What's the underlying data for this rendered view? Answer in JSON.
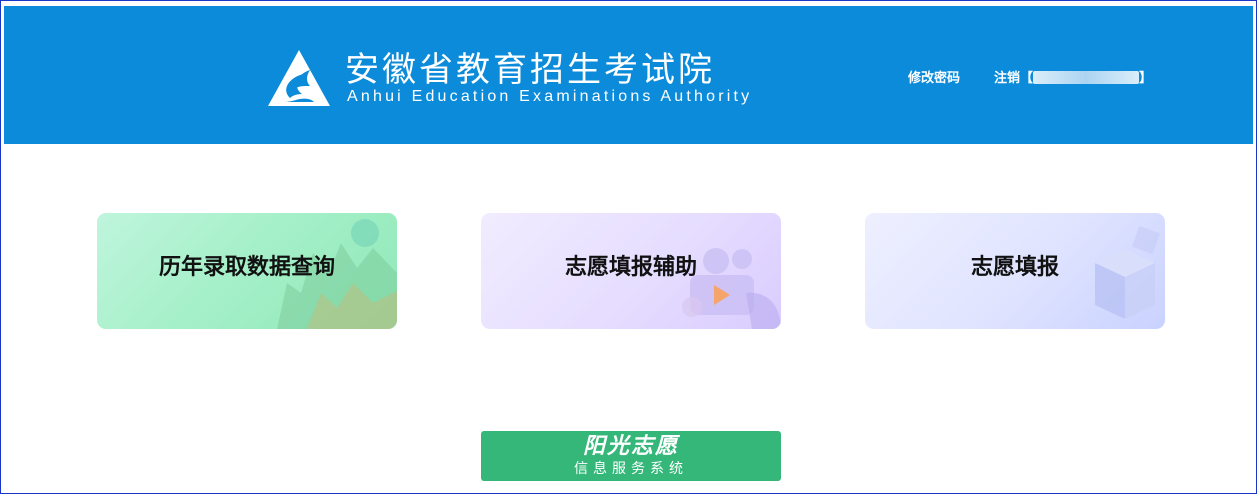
{
  "header": {
    "brand_cn": "安徽省教育招生考试院",
    "brand_en": "Anhui Education Examinations Authority",
    "change_password": "修改密码",
    "logout": "注销【",
    "logout_close": "】"
  },
  "cards": [
    {
      "label": "历年录取数据查询"
    },
    {
      "label": "志愿填报辅助"
    },
    {
      "label": "志愿填报"
    }
  ],
  "banner": {
    "title": "阳光志愿",
    "subtitle": "信息服务系统"
  },
  "colors": {
    "header_bg": "#0b8bd9",
    "banner_bg": "#35b77a",
    "frame_border": "#1b35c9"
  }
}
